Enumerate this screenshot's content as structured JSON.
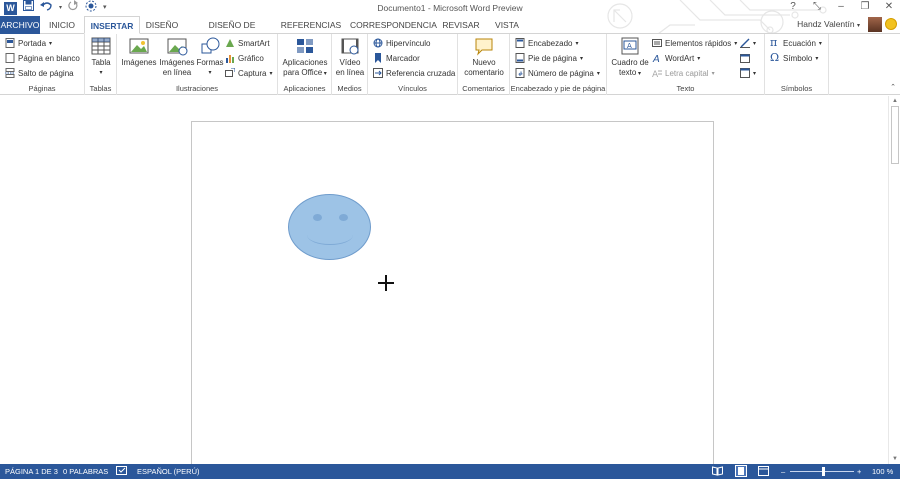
{
  "window": {
    "title": "Documento1 - Microsoft Word Preview"
  },
  "qat": {
    "app_icon": "W",
    "save_icon": "save-icon",
    "undo_icon": "undo-icon",
    "redo_icon": "redo-icon",
    "touch_icon": "touch-mode-icon",
    "more_icon": "customize-qat-icon"
  },
  "window_controls": {
    "help": "?",
    "restore_ribbon": "⤡",
    "minimize": "–",
    "maximize": "❐",
    "close": "✕"
  },
  "tabs": [
    "ARCHIVO",
    "INICIO",
    "INSERTAR",
    "DISEÑO",
    "DISEÑO DE PÁGINA",
    "REFERENCIAS",
    "CORRESPONDENCIA",
    "REVISAR",
    "VISTA"
  ],
  "active_tab": "INSERTAR",
  "user": {
    "name": "Handz Valentín"
  },
  "ribbon": {
    "paginas": {
      "label": "Páginas",
      "items": [
        "Portada",
        "Página en blanco",
        "Salto de página"
      ]
    },
    "tablas": {
      "label": "Tablas",
      "table": "Tabla"
    },
    "ilustraciones": {
      "label": "Ilustraciones",
      "imagenes": "Imágenes",
      "imagenes_linea_1": "Imágenes",
      "imagenes_linea_2": "en línea",
      "formas": "Formas",
      "smartart": "SmartArt",
      "grafico": "Gráfico",
      "captura": "Captura"
    },
    "aplicaciones": {
      "label": "Aplicaciones",
      "line1": "Aplicaciones",
      "line2": "para Office"
    },
    "medios": {
      "label": "Medios",
      "line1": "Vídeo",
      "line2": "en línea"
    },
    "vinculos": {
      "label": "Vínculos",
      "items": [
        "Hipervínculo",
        "Marcador",
        "Referencia cruzada"
      ]
    },
    "comentarios": {
      "label": "Comentarios",
      "line1": "Nuevo",
      "line2": "comentario"
    },
    "encabezado": {
      "label": "Encabezado y pie de página",
      "items": [
        "Encabezado",
        "Pie de página",
        "Número de página"
      ]
    },
    "texto": {
      "label": "Texto",
      "cuadro_1": "Cuadro de",
      "cuadro_2": "texto",
      "items": [
        "Elementos rápidos",
        "WordArt",
        "Letra capital"
      ]
    },
    "simbolos": {
      "label": "Símbolos",
      "items": [
        "Ecuación",
        "Símbolo"
      ]
    }
  },
  "status": {
    "page": "PÁGINA 1 DE 3",
    "words": "0 PALABRAS",
    "language": "ESPAÑOL (PERÚ)",
    "zoom": "100 %",
    "zoom_minus": "–",
    "zoom_plus": "+"
  },
  "colors": {
    "accent": "#2b579a",
    "face_fill": "#9dc3e6"
  }
}
